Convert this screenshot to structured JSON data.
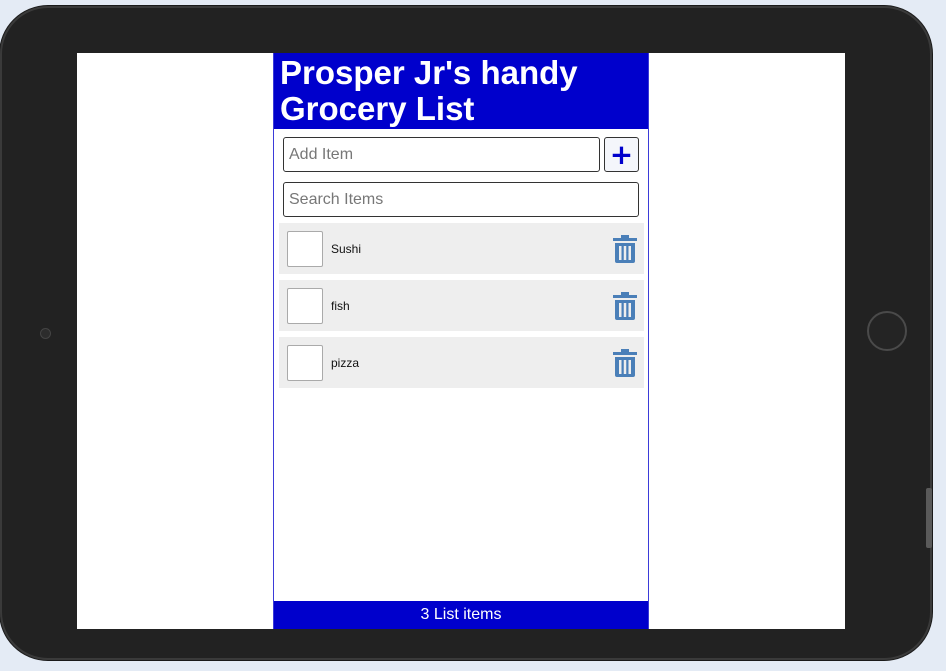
{
  "app": {
    "title": "Prosper Jr's handy Grocery List"
  },
  "add_item": {
    "placeholder": "Add Item",
    "value": "",
    "button_label": "+"
  },
  "search": {
    "placeholder": "Search Items",
    "value": ""
  },
  "items": [
    {
      "label": "Sushi",
      "checked": false
    },
    {
      "label": "fish",
      "checked": false
    },
    {
      "label": "pizza",
      "checked": false
    }
  ],
  "footer": {
    "count_text": "3 List items"
  },
  "colors": {
    "brand": "#0000cc",
    "item_bg": "#eeeeee",
    "trash": "#4a7fb8",
    "device_frame": "#222222"
  },
  "icons": {
    "add": "plus-icon",
    "delete": "trash-icon"
  }
}
